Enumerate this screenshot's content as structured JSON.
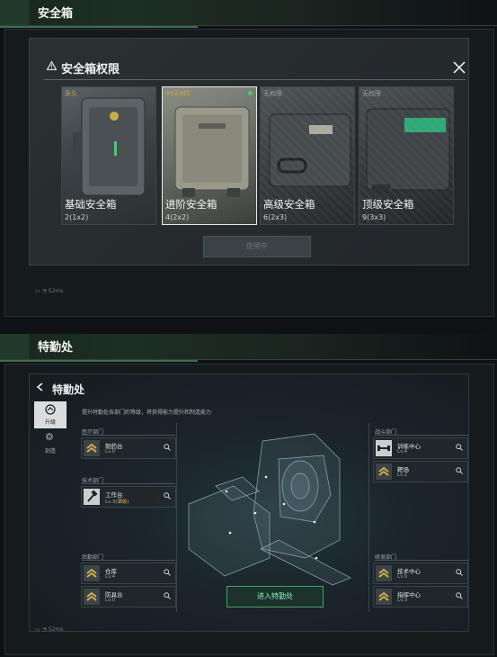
{
  "safebox_section": {
    "header_title": "安全箱",
    "dialog_title": "安全箱权限",
    "cards": [
      {
        "tag": "永久",
        "name": "基础安全箱",
        "size": "2(1x2)",
        "selected": false
      },
      {
        "tag": "49天8时",
        "name": "进阶安全箱",
        "size": "4(2x2)",
        "selected": true
      },
      {
        "tag": "无权限",
        "name": "高级安全箱",
        "size": "6(2x3)",
        "selected": false
      },
      {
        "tag": "无权限",
        "name": "顶级安全箱",
        "size": "9(3x3)",
        "selected": false
      }
    ],
    "action_button": "使用中",
    "status_text": "52ms"
  },
  "special_section": {
    "header_title": "特勤处",
    "panel_title": "特勤处",
    "description": "提升特勤处各部门的等级，将获得能力提升和制造能力",
    "tabs": [
      {
        "label": "升级",
        "icon": "upgrade-icon",
        "active": true
      },
      {
        "label": "刻造",
        "icon": "gear-icon",
        "active": false
      }
    ],
    "departments": {
      "medical": {
        "label": "医疗部门",
        "items": [
          {
            "name": "制药台",
            "level": "Lv.0",
            "extra": ""
          }
        ]
      },
      "tech": {
        "label": "技术部门",
        "items": [
          {
            "name": "工作台",
            "level": "Lv.3",
            "extra": "(满级)"
          }
        ]
      },
      "logistics": {
        "label": "后勤部门",
        "items": [
          {
            "name": "仓库",
            "level": "Lv.4",
            "extra": ""
          },
          {
            "name": "防具台",
            "level": "Lv.0",
            "extra": ""
          }
        ]
      },
      "combat": {
        "label": "战斗部门",
        "items": [
          {
            "name": "训练中心",
            "level": "Lv.4",
            "extra": ""
          },
          {
            "name": "靶场",
            "level": "Lv.2",
            "extra": ""
          }
        ]
      },
      "research": {
        "label": "研发部门",
        "items": [
          {
            "name": "技术中心",
            "level": "Lv.0",
            "extra": ""
          },
          {
            "name": "指挥中心",
            "level": "Lv.3",
            "extra": ""
          }
        ]
      }
    },
    "enter_button": "进入特勤处",
    "status_text": "52ms"
  },
  "colors": {
    "accent_green": "#3fa36a",
    "gold_level": "#d6b24c",
    "tag_gold": "#c8a84a"
  }
}
